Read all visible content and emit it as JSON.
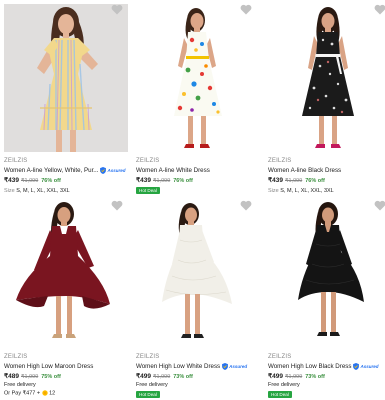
{
  "products": [
    {
      "brand": "ZEILZIS",
      "title": "Women A-line Yellow, White, Pur...",
      "price": "₹439",
      "mrp": "₹1,099",
      "off": "76% off",
      "assured": "Assured",
      "sizes_label": "Size",
      "sizes": "S, M, L, XL, XXL, 3XL",
      "dress_color": "#f2d88c"
    },
    {
      "brand": "ZEILZIS",
      "title": "Women A-line White Dress",
      "price": "₹439",
      "mrp": "₹1,099",
      "off": "76% off",
      "tag": "Hot Deal",
      "dress_color": "#fafaf2"
    },
    {
      "brand": "ZEILZIS",
      "title": "Women A-line Black Dress",
      "price": "₹439",
      "mrp": "₹1,099",
      "off": "76% off",
      "sizes_label": "Size",
      "sizes": "S, M, L, XL, XXL, 3XL",
      "dress_color": "#1b1b1b"
    },
    {
      "brand": "ZEILZIS",
      "title": "Women High Low Maroon Dress",
      "price": "₹489",
      "mrp": "₹1,999",
      "off": "75% off",
      "delivery": "Free delivery",
      "pay": "Or Pay ₹477 + ",
      "coins": "12",
      "dress_color": "#7a1520"
    },
    {
      "brand": "ZEILZIS",
      "title": "Women High Low White Dress",
      "price": "₹499",
      "mrp": "₹1,999",
      "off": "73% off",
      "assured": "Assured",
      "delivery": "Free delivery",
      "tag": "Hot Deal",
      "dress_color": "#f1efe8"
    },
    {
      "brand": "ZEILZIS",
      "title": "Women High Low Black Dress",
      "price": "₹499",
      "mrp": "₹1,999",
      "off": "73% off",
      "assured": "Assured",
      "delivery": "Free delivery",
      "tag": "Hot Deal",
      "dress_color": "#141414"
    }
  ]
}
